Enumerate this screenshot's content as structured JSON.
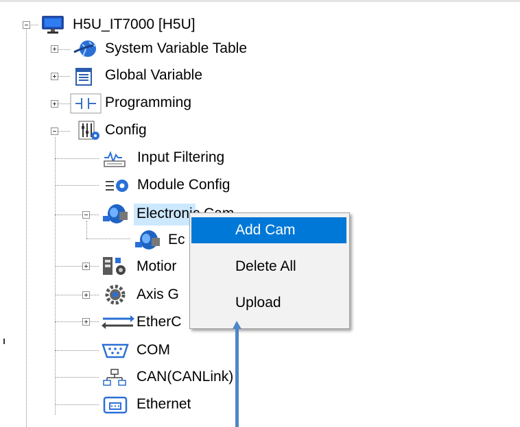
{
  "tree": {
    "root": {
      "label": "H5U_IT7000 [H5U]",
      "icon": "monitor-icon"
    },
    "items": [
      {
        "label": "System Variable Table",
        "icon": "globe-icon"
      },
      {
        "label": "Global Variable",
        "icon": "table-icon"
      },
      {
        "label": "Programming",
        "icon": "ladder-icon"
      },
      {
        "label": "Config",
        "icon": "config-sliders-icon"
      },
      {
        "label": "Input Filtering",
        "icon": "waveform-icon"
      },
      {
        "label": "Module Config",
        "icon": "module-gear-icon"
      },
      {
        "label": "Electronic Cam",
        "icon": "cam-icon"
      },
      {
        "label": "Ec",
        "icon": "cam-icon"
      },
      {
        "label": "Motior",
        "icon": "motion-icon"
      },
      {
        "label": "Axis G",
        "icon": "axis-gear-icon"
      },
      {
        "label": "EtherC",
        "icon": "ethercat-arrows-icon"
      },
      {
        "label": "COM",
        "icon": "serial-port-icon"
      },
      {
        "label": "CAN(CANLink)",
        "icon": "network-icon"
      },
      {
        "label": "Ethernet",
        "icon": "ethernet-icon"
      }
    ]
  },
  "context_menu": {
    "items": [
      {
        "label": "Add Cam",
        "highlighted": true
      },
      {
        "label": "Delete All",
        "highlighted": false
      },
      {
        "label": "Upload",
        "highlighted": false
      }
    ]
  },
  "colors": {
    "menu_highlight": "#0078d7",
    "selection": "#cce8ff",
    "annotation_arrow": "#4f86c6"
  }
}
